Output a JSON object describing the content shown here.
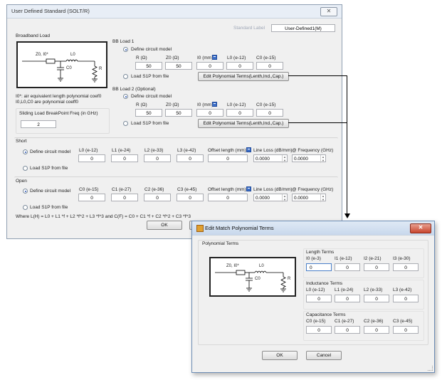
{
  "main": {
    "title": "User Defined Standard (SOLT/R)",
    "close": "✕",
    "std_label_caption": "Standard Label",
    "std_label_value": "User-Defined1(M)",
    "broadband": {
      "label": "Broadband Load",
      "note1": "I0*: air equivalent length polynomial coef0",
      "note2": "I0,L0,C0 are polynomial coeff0",
      "sliding_label": "Sliding Load BreakPoint Freq (in GHz)",
      "sliding_value": "2"
    },
    "schematic": {
      "z0": "Z0, I0*",
      "l0": "L0",
      "c0": "C0",
      "r": "R"
    },
    "bb1": {
      "label": "BB Load 1",
      "define": "Define circuit model",
      "headers": [
        "R (Ω)",
        "Z0 (Ω)",
        "I0 (mm)",
        "L0 (e-12)",
        "C0 (e-15)"
      ],
      "values": [
        "50",
        "50",
        "0",
        "0",
        "0"
      ],
      "load": "Load S1P from file",
      "edit": "Edit Polynomial Terms(Lenth,Ind.,Cap.)"
    },
    "bb2": {
      "label": "BB Load 2 (Optional)",
      "define": "Define circuit model",
      "headers": [
        "R (Ω)",
        "Z0 (Ω)",
        "I0 (mm)",
        "L0 (e-12)",
        "C0 (e-15)"
      ],
      "values": [
        "50",
        "50",
        "0",
        "0",
        "0"
      ],
      "load": "Load S1P from file",
      "edit": "Edit Polynomial Terms(Lenth,Ind.,Cap.)"
    },
    "short": {
      "label": "Short",
      "define": "Define circuit model",
      "headers": [
        "L0 (e-12)",
        "L1 (e-24)",
        "L2 (e-33)",
        "L3 (e-42)",
        "Offset length (mm)",
        "Line Loss (dB/mm)",
        "@ Frequency (GHz)"
      ],
      "values": [
        "0",
        "0",
        "0",
        "0",
        "0",
        "0.0000",
        "0.0000"
      ],
      "load": "Load S1P from file"
    },
    "open": {
      "label": "Open",
      "define": "Define circuit model",
      "headers": [
        "C0 (e-15)",
        "C1 (e-27)",
        "C2 (e-36)",
        "C3 (e-45)",
        "Offset length (mm)",
        "Line Loss (dB/mm)",
        "@ Frequency (GHz)"
      ],
      "values": [
        "0",
        "0",
        "0",
        "0",
        "0",
        "0.0000",
        "0.0000"
      ],
      "load": "Load S1P from file"
    },
    "formula": "Where L(H) = L0 + L1 *f + L2 *f^2 + L3 *f^3  and  C(F) = C0 + C1 *f + C2 *f^2 + C3 *f^3",
    "ok": "OK"
  },
  "dialog": {
    "title": "Edit Match Polynomial Terms",
    "close": "✕",
    "group": "Polynomial Terms",
    "length": {
      "label": "Length Terms",
      "headers": [
        "I0 (e-3)",
        "I1 (e-12)",
        "I2 (e-21)",
        "I3 (e-30)"
      ],
      "values": [
        "0",
        "0",
        "0",
        "0"
      ]
    },
    "inductance": {
      "label": "Inductance Terms",
      "headers": [
        "L0 (e-12)",
        "L1 (e-24)",
        "L2 (e-33)",
        "L3 (e-42)"
      ],
      "values": [
        "0",
        "0",
        "0",
        "0"
      ]
    },
    "capacitance": {
      "label": "Capacitance Terms",
      "headers": [
        "C0 (e-15)",
        "C1 (e-27)",
        "C2 (e-36)",
        "C3 (e-45)"
      ],
      "values": [
        "0",
        "0",
        "0",
        "0"
      ]
    },
    "ok": "OK",
    "cancel": "Cancel"
  }
}
